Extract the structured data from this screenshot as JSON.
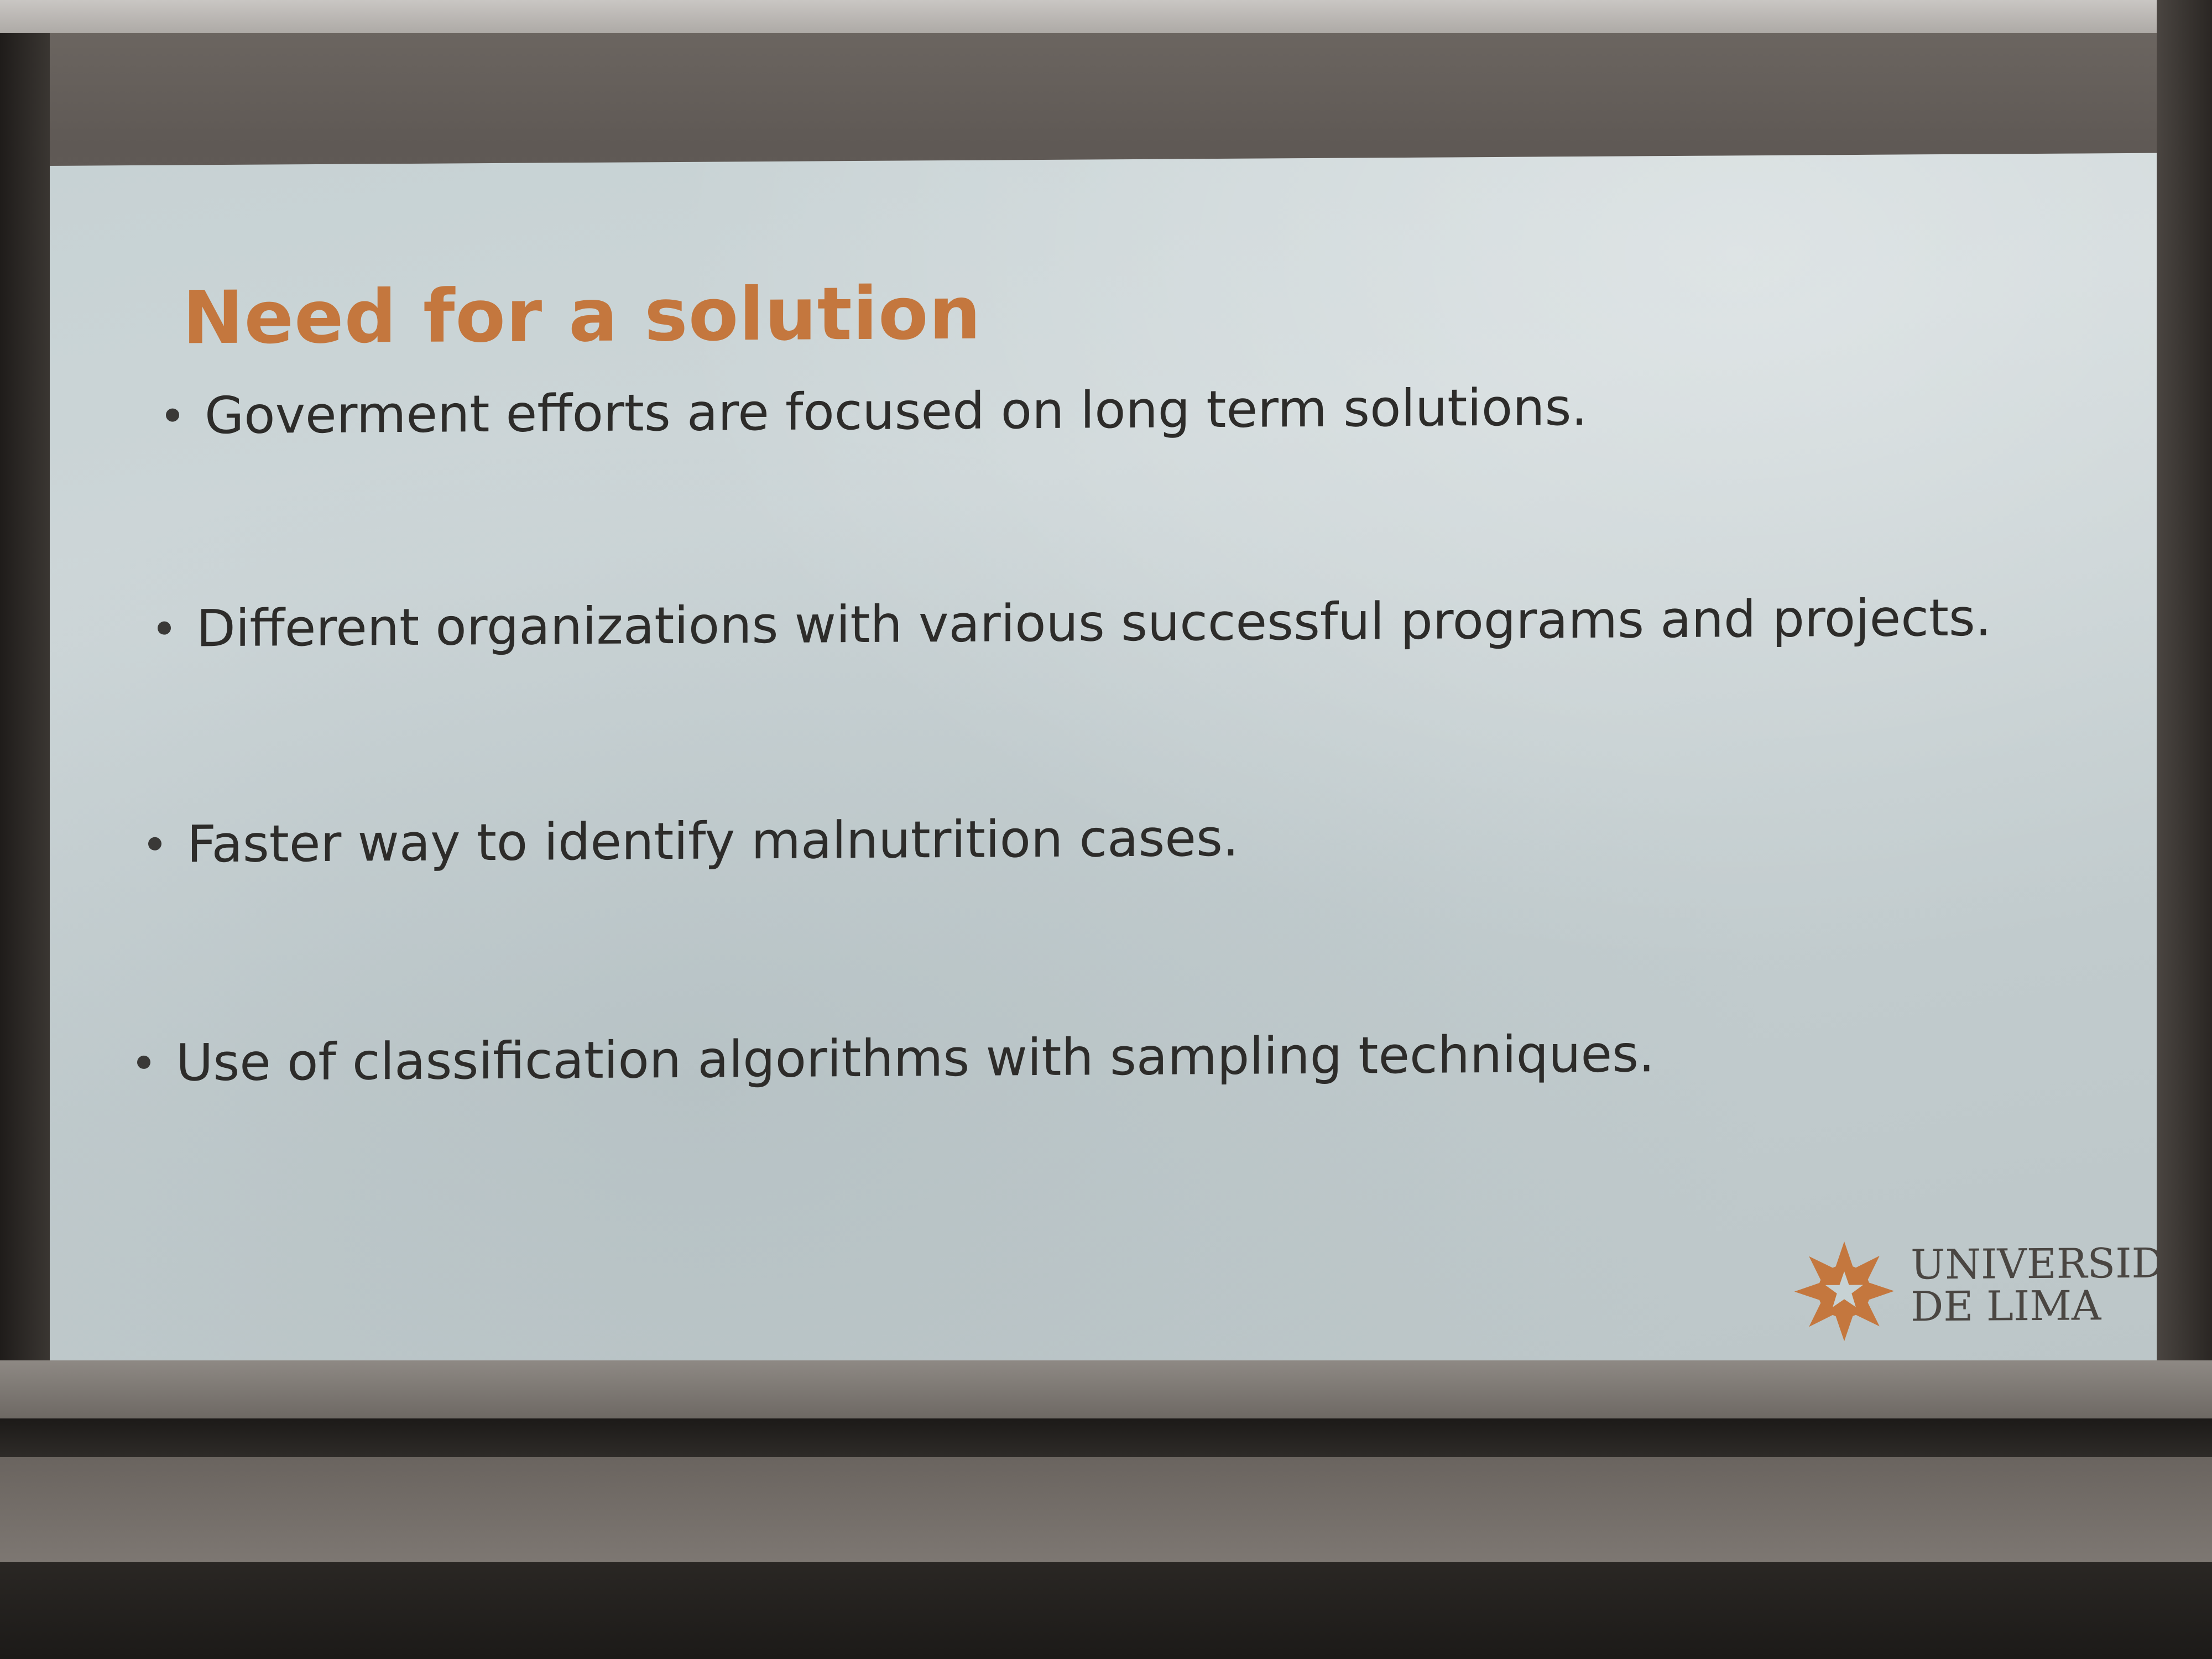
{
  "slide": {
    "title": "Need for a solution",
    "bullets": [
      "Goverment efforts are focused on long term solutions.",
      "Different organizations with various successful programs and projects.",
      "Faster way to identify malnutrition cases.",
      "Use of classification algorithms with sampling techniques."
    ],
    "logo": {
      "line1": "UNIVERSIDAD",
      "line2": "DE LIMA",
      "icon": "star-burst-icon",
      "color": "#c4773e"
    }
  },
  "colors": {
    "title": "#c4773e",
    "text": "#2d2c2a",
    "slide_background": "#c7d2d4"
  }
}
